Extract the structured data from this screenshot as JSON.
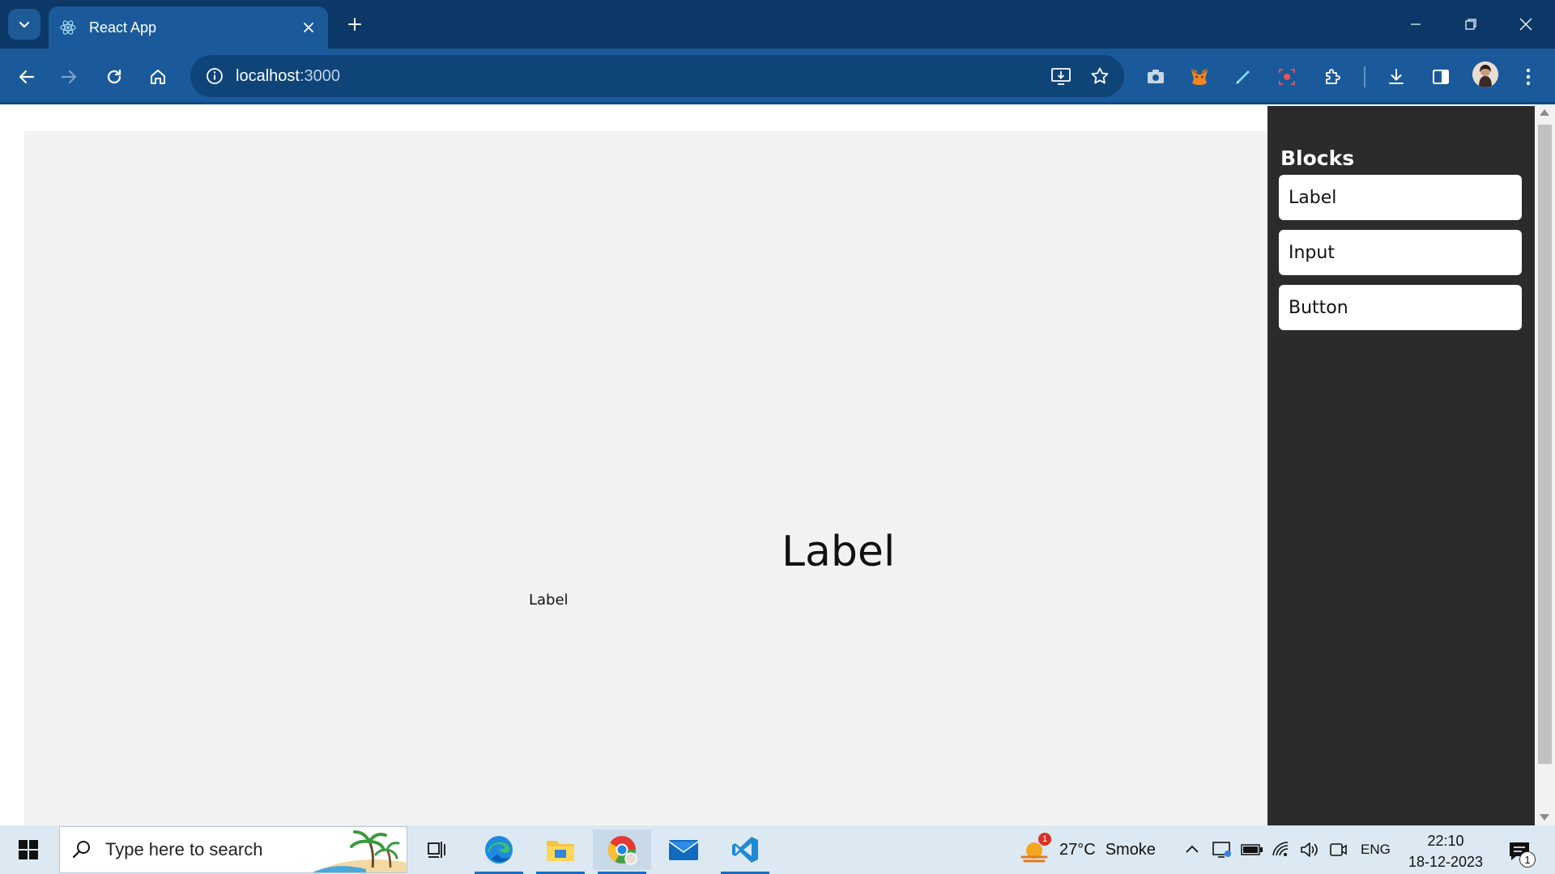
{
  "browser": {
    "tab_title": "React App",
    "url_host": "localhost",
    "url_port": ":3000"
  },
  "canvas": {
    "label_large": "Label",
    "label_small": "Label"
  },
  "sidebar": {
    "title": "Blocks",
    "items": [
      {
        "label": "Label"
      },
      {
        "label": "Input"
      },
      {
        "label": "Button"
      }
    ]
  },
  "taskbar": {
    "search_placeholder": "Type here to search",
    "weather_temp": "27°C",
    "weather_desc": "Smoke",
    "weather_alert": "1",
    "language": "ENG",
    "time": "22:10",
    "date": "18-12-2023",
    "notifications": "1"
  },
  "colors": {
    "chrome_dark": "#0b3866",
    "chrome": "#1a5a9a",
    "sidebar_bg": "#2b2b2b",
    "canvas_bg": "#f2f2f2",
    "taskbar_bg": "#dce9f3"
  }
}
